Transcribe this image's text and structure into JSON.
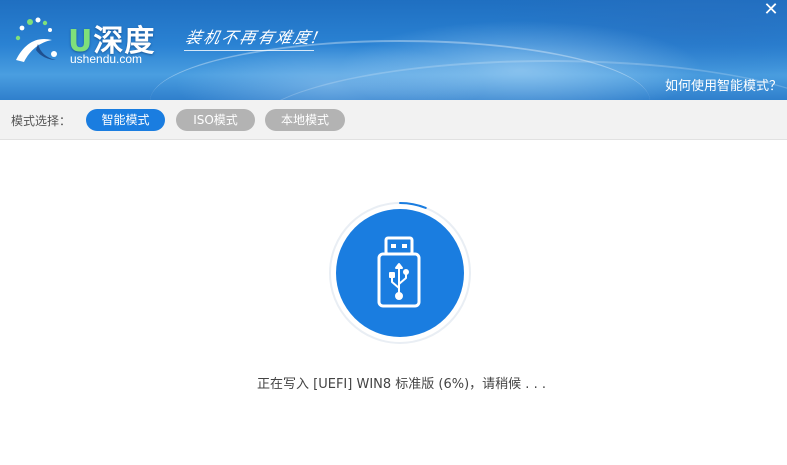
{
  "header": {
    "logo_u": "U",
    "logo_text": "深度",
    "logo_domain": "ushendu.com",
    "slogan": "装机不再有难度!",
    "close_glyph": "✕",
    "help_link": "如何使用智能模式？"
  },
  "modebar": {
    "label": "模式选择：",
    "modes": [
      {
        "label": "智能模式",
        "active": true
      },
      {
        "label": "ISO模式",
        "active": false
      },
      {
        "label": "本地模式",
        "active": false
      }
    ]
  },
  "main": {
    "icon": "usb-drive-icon",
    "progress_percent": 6,
    "status": "正在写入 [UEFI] WIN8 标准版 (6%)，请稍候 . . ."
  },
  "colors": {
    "accent": "#1a7de0",
    "inactive": "#b3b3b3",
    "ring": "#1a7de0"
  }
}
